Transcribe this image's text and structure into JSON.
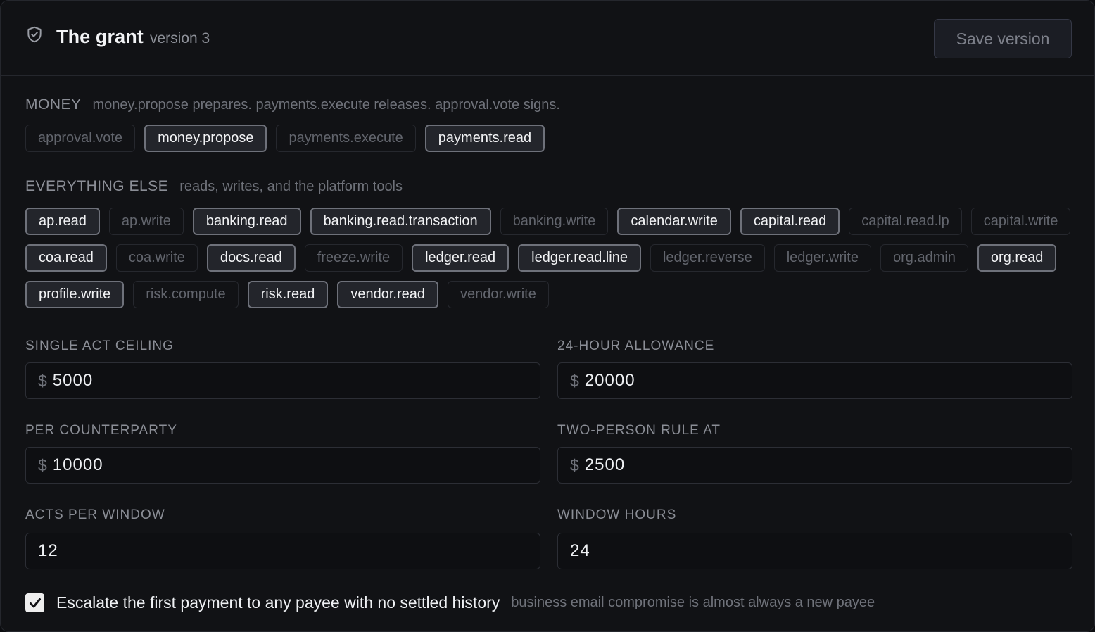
{
  "header": {
    "icon": "shield-check-icon",
    "title": "The grant",
    "version": "version 3",
    "save_label": "Save version"
  },
  "money": {
    "title": "MONEY",
    "description": "money.propose prepares. payments.execute releases. approval.vote signs.",
    "chips": [
      {
        "label": "approval.vote",
        "selected": false
      },
      {
        "label": "money.propose",
        "selected": true
      },
      {
        "label": "payments.execute",
        "selected": false
      },
      {
        "label": "payments.read",
        "selected": true
      }
    ]
  },
  "everything_else": {
    "title": "EVERYTHING ELSE",
    "description": "reads, writes, and the platform tools",
    "chips": [
      {
        "label": "ap.read",
        "selected": true
      },
      {
        "label": "ap.write",
        "selected": false
      },
      {
        "label": "banking.read",
        "selected": true
      },
      {
        "label": "banking.read.transaction",
        "selected": true
      },
      {
        "label": "banking.write",
        "selected": false
      },
      {
        "label": "calendar.write",
        "selected": true
      },
      {
        "label": "capital.read",
        "selected": true
      },
      {
        "label": "capital.read.lp",
        "selected": false
      },
      {
        "label": "capital.write",
        "selected": false
      },
      {
        "label": "coa.read",
        "selected": true
      },
      {
        "label": "coa.write",
        "selected": false
      },
      {
        "label": "docs.read",
        "selected": true
      },
      {
        "label": "freeze.write",
        "selected": false
      },
      {
        "label": "ledger.read",
        "selected": true
      },
      {
        "label": "ledger.read.line",
        "selected": true
      },
      {
        "label": "ledger.reverse",
        "selected": false
      },
      {
        "label": "ledger.write",
        "selected": false
      },
      {
        "label": "org.admin",
        "selected": false
      },
      {
        "label": "org.read",
        "selected": true
      },
      {
        "label": "profile.write",
        "selected": true
      },
      {
        "label": "risk.compute",
        "selected": false
      },
      {
        "label": "risk.read",
        "selected": true
      },
      {
        "label": "vendor.read",
        "selected": true
      },
      {
        "label": "vendor.write",
        "selected": false
      }
    ]
  },
  "limits": {
    "currency_symbol": "$",
    "single_act_ceiling": {
      "label": "SINGLE ACT CEILING",
      "value": "5000"
    },
    "allowance_24h": {
      "label": "24-HOUR ALLOWANCE",
      "value": "20000"
    },
    "per_counterparty": {
      "label": "PER COUNTERPARTY",
      "value": "10000"
    },
    "two_person_rule": {
      "label": "TWO-PERSON RULE AT",
      "value": "2500"
    },
    "acts_per_window": {
      "label": "ACTS PER WINDOW",
      "value": "12"
    },
    "window_hours": {
      "label": "WINDOW HOURS",
      "value": "24"
    }
  },
  "escalation": {
    "checked": true,
    "label": "Escalate the first payment to any payee with no settled history",
    "hint": "business email compromise is almost always a new payee"
  },
  "colors": {
    "background": "#111215",
    "chip_selected_border": "#6e717a",
    "text_primary": "#f2f3f5",
    "text_muted": "#6f727a"
  }
}
